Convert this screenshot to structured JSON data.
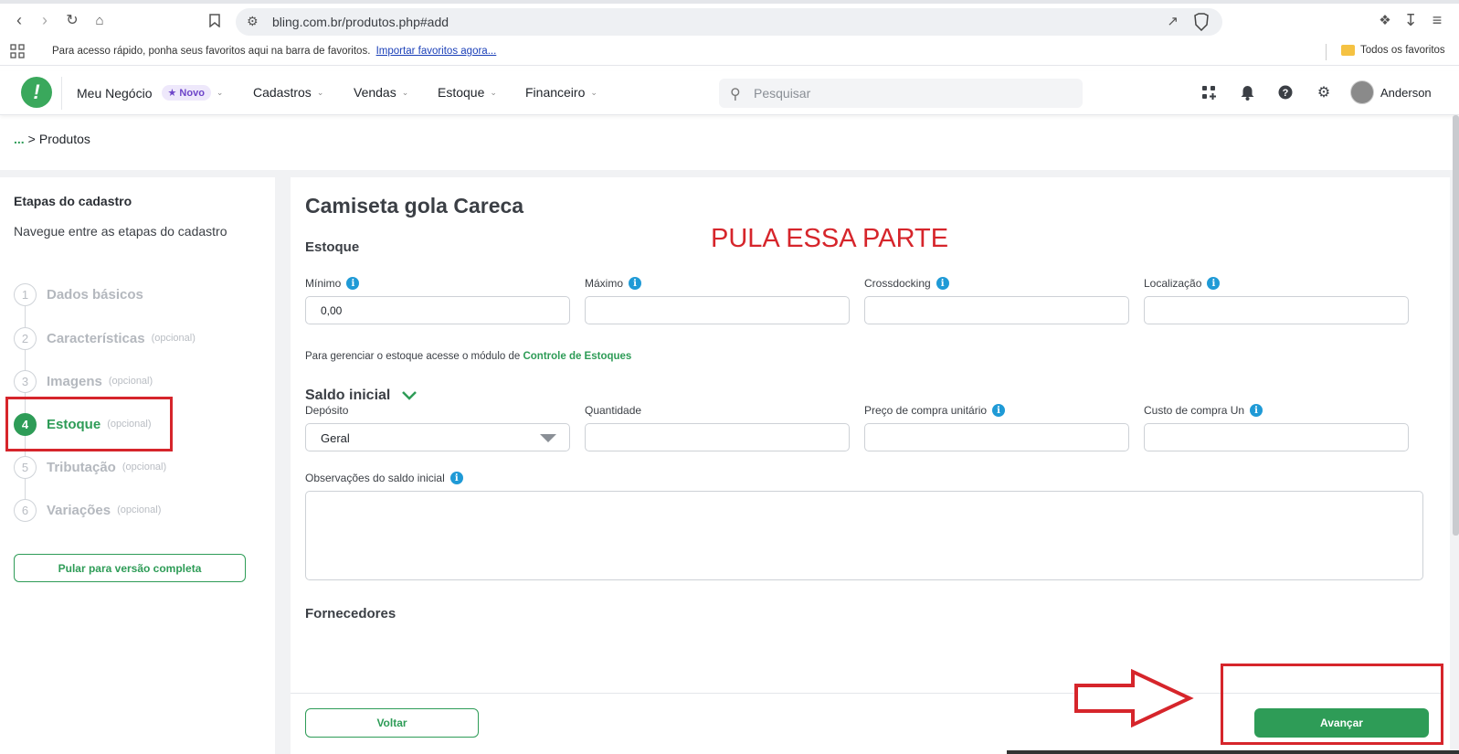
{
  "browser": {
    "url": "bling.com.br/produtos.php#add",
    "bookmarks_msg": "Para acesso rápido, ponha seus favoritos aqui na barra de favoritos.",
    "bookmarks_link": "Importar favoritos agora...",
    "all_favorites": "Todos os favoritos"
  },
  "header": {
    "logo": "!",
    "business": "Meu Negócio",
    "badge": "★ Novo",
    "menus": [
      "Cadastros",
      "Vendas",
      "Estoque",
      "Financeiro"
    ],
    "search_placeholder": "Pesquisar",
    "username": "Anderson"
  },
  "breadcrumb": {
    "dots": "...",
    "separator": ">",
    "current": "Produtos"
  },
  "sidebar": {
    "title": "Etapas do cadastro",
    "subtitle": "Navegue entre as etapas do cadastro",
    "steps": [
      {
        "num": "1",
        "label": "Dados básicos",
        "optional": ""
      },
      {
        "num": "2",
        "label": "Características",
        "optional": "(opcional)"
      },
      {
        "num": "3",
        "label": "Imagens",
        "optional": "(opcional)"
      },
      {
        "num": "4",
        "label": "Estoque",
        "optional": "(opcional)",
        "active": true
      },
      {
        "num": "5",
        "label": "Tributação",
        "optional": "(opcional)"
      },
      {
        "num": "6",
        "label": "Variações",
        "optional": "(opcional)"
      }
    ],
    "skip_button": "Pular para versão completa"
  },
  "main": {
    "title": "Camiseta gola Careca",
    "annotation": "PULA ESSA PARTE",
    "section_estoque": "Estoque",
    "fields_row1": [
      {
        "label": "Mínimo",
        "value": "0,00",
        "info": true
      },
      {
        "label": "Máximo",
        "value": "",
        "info": true
      },
      {
        "label": "Crossdocking",
        "value": "",
        "info": true
      },
      {
        "label": "Localização",
        "value": "",
        "info": true
      }
    ],
    "hint_text": "Para gerenciar o estoque acesse o módulo de",
    "hint_link": "Controle de Estoques",
    "section_saldo": "Saldo inicial",
    "deposito_label": "Depósito",
    "deposito_value": "Geral",
    "fields_row2": [
      {
        "label": "Quantidade",
        "value": "",
        "info": false
      },
      {
        "label": "Preço de compra unitário",
        "value": "",
        "info": true
      },
      {
        "label": "Custo de compra Un",
        "value": "",
        "info": true
      }
    ],
    "obs_label": "Observações do saldo inicial",
    "section_fornecedores": "Fornecedores"
  },
  "footer": {
    "back": "Voltar",
    "next": "Avançar"
  },
  "colors": {
    "brand_green": "#2e9c57",
    "annotation_red": "#d6252b",
    "info_blue": "#1f9ad6"
  }
}
